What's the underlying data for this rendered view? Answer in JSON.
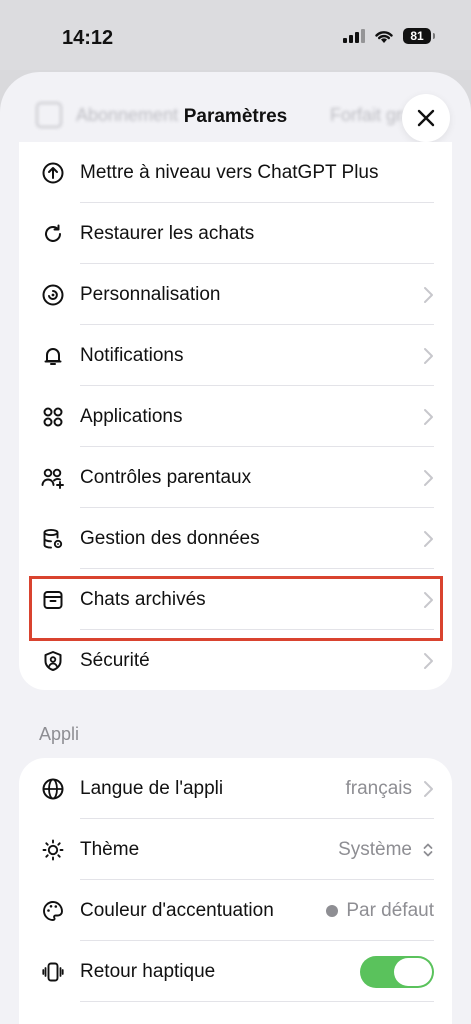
{
  "status_bar": {
    "time": "14:12",
    "battery": "81"
  },
  "sheet": {
    "title": "Paramètres",
    "ghost_left": "Abonnement",
    "ghost_right": "Forfait gratuit"
  },
  "account_items": [
    {
      "label": "Mettre à niveau vers ChatGPT Plus",
      "icon": "arrow-up-circle-icon",
      "chevron": false
    },
    {
      "label": "Restaurer les achats",
      "icon": "refresh-icon",
      "chevron": false
    },
    {
      "label": "Personnalisation",
      "icon": "personalization-icon",
      "chevron": true
    },
    {
      "label": "Notifications",
      "icon": "bell-icon",
      "chevron": true
    },
    {
      "label": "Applications",
      "icon": "grid-icon",
      "chevron": true
    },
    {
      "label": "Contrôles parentaux",
      "icon": "people-add-icon",
      "chevron": true
    },
    {
      "label": "Gestion des données",
      "icon": "database-gear-icon",
      "chevron": true,
      "highlighted": true
    },
    {
      "label": "Chats archivés",
      "icon": "archive-icon",
      "chevron": true
    },
    {
      "label": "Sécurité",
      "icon": "shield-person-icon",
      "chevron": true
    }
  ],
  "app_section": {
    "header": "Appli",
    "items": [
      {
        "label": "Langue de l'appli",
        "value": "français",
        "icon": "globe-icon"
      },
      {
        "label": "Thème",
        "value": "Système",
        "icon": "sun-icon"
      },
      {
        "label": "Couleur d'accentuation",
        "value": "Par défaut",
        "icon": "palette-icon"
      },
      {
        "label": "Retour haptique",
        "toggle": true,
        "icon": "haptic-icon"
      }
    ]
  },
  "colors": {
    "highlight": "#d9432f",
    "toggle_on": "#5ac25c",
    "accent_dot": "#8e8e93"
  }
}
